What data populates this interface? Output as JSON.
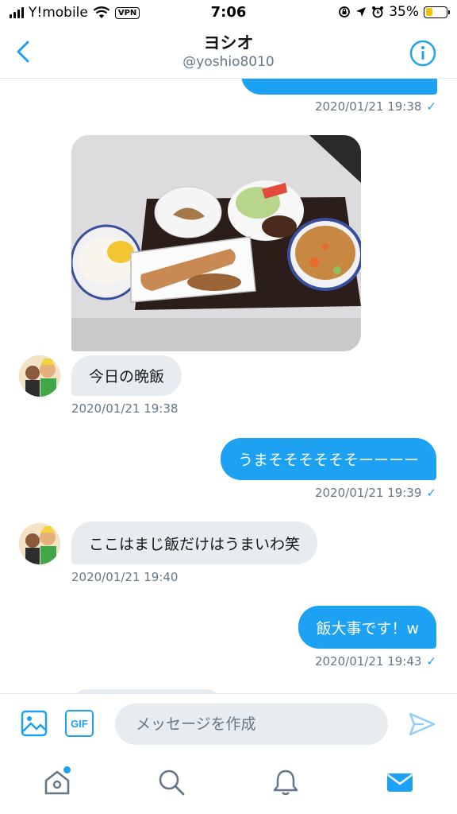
{
  "status_bar": {
    "carrier": "Y!mobile",
    "vpn": "VPN",
    "time": "7:06",
    "battery": "35%",
    "battery_level": 0.35
  },
  "header": {
    "title": "ヨシオ",
    "handle": "@yoshio8010"
  },
  "messages": {
    "m0_time": "2020/01/21 19:38",
    "m1_text": "今日の晩飯",
    "m1_time": "2020/01/21 19:38",
    "m2_text": "うまそそそそそそーーーー",
    "m2_time": "2020/01/21 19:39",
    "m3_text": "ここはまじ飯だけはうまいわ笑",
    "m3_time": "2020/01/21 19:40",
    "m4_text": "飯大事です！w",
    "m4_time": "2020/01/21 19:43",
    "read_mark": "✓"
  },
  "composer": {
    "gif_label": "GIF",
    "placeholder": "メッセージを作成"
  },
  "icons": {
    "back": "chevron-left-icon",
    "info": "info-icon",
    "image": "image-icon",
    "send": "send-icon",
    "home": "home-icon",
    "search": "search-icon",
    "notifications": "bell-icon",
    "messages": "mail-icon"
  },
  "colors": {
    "accent": "#1da1f2",
    "incoming_bubble": "#e6ecf0",
    "secondary_text": "#657786"
  }
}
